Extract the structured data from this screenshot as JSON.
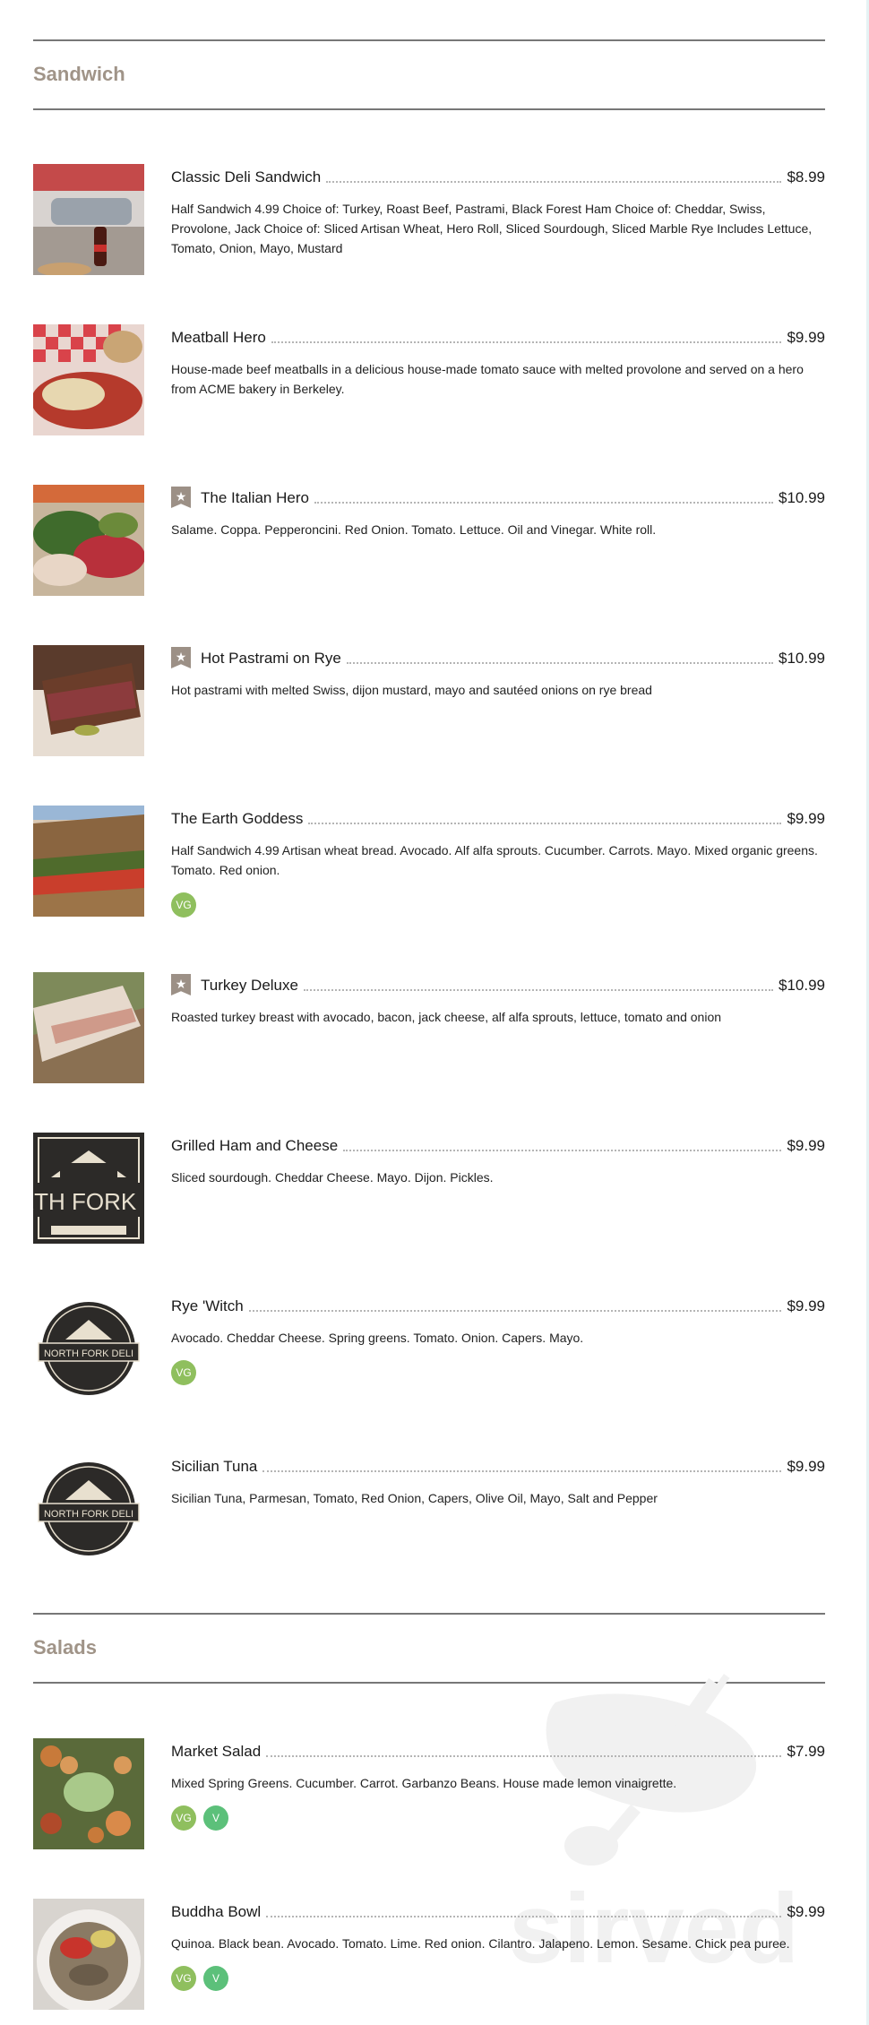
{
  "sections": [
    {
      "id": "sandwich",
      "title": "Sandwich"
    },
    {
      "id": "salads",
      "title": "Salads"
    }
  ],
  "items": [
    {
      "name": "Classic Deli Sandwich",
      "price": "$8.99",
      "featured": false,
      "description": "Half Sandwich 4.99 Choice of: Turkey, Roast Beef, Pastrami, Black Forest Ham Choice of: Cheddar, Swiss, Provolone, Jack Choice of: Sliced Artisan Wheat, Hero Roll, Sliced Sourdough, Sliced Marble Rye Includes Lettuce, Tomato, Onion, Mayo, Mustard",
      "tags": []
    },
    {
      "name": "Meatball Hero",
      "price": "$9.99",
      "featured": false,
      "description": "House-made beef meatballs in a delicious house-made tomato sauce with melted provolone and served on a hero from ACME bakery in Berkeley.",
      "tags": []
    },
    {
      "name": "The Italian Hero",
      "price": "$10.99",
      "featured": true,
      "description": "Salame. Coppa. Pepperoncini. Red Onion. Tomato. Lettuce. Oil and Vinegar. White roll.",
      "tags": []
    },
    {
      "name": "Hot Pastrami on Rye",
      "price": "$10.99",
      "featured": true,
      "description": "Hot pastrami with melted Swiss, dijon mustard, mayo and sautéed onions on rye bread",
      "tags": []
    },
    {
      "name": "The Earth Goddess",
      "price": "$9.99",
      "featured": false,
      "description": "Half Sandwich 4.99 Artisan wheat bread. Avocado. Alf alfa sprouts. Cucumber. Carrots. Mayo. Mixed organic greens. Tomato. Red onion.",
      "tags": [
        "VG"
      ]
    },
    {
      "name": "Turkey Deluxe",
      "price": "$10.99",
      "featured": true,
      "description": "Roasted turkey breast with avocado, bacon, jack cheese, alf alfa sprouts, lettuce, tomato and onion",
      "tags": []
    },
    {
      "name": "Grilled Ham and Cheese",
      "price": "$9.99",
      "featured": false,
      "description": "Sliced sourdough. Cheddar Cheese. Mayo. Dijon. Pickles.",
      "tags": []
    },
    {
      "name": "Rye 'Witch",
      "price": "$9.99",
      "featured": false,
      "description": "Avocado. Cheddar Cheese. Spring greens. Tomato. Onion. Capers. Mayo.",
      "tags": [
        "VG"
      ]
    },
    {
      "name": "Sicilian Tuna",
      "price": "$9.99",
      "featured": false,
      "description": "Sicilian Tuna, Parmesan, Tomato, Red Onion, Capers, Olive Oil, Mayo, Salt and Pepper",
      "tags": []
    },
    {
      "name": "Market Salad",
      "price": "$7.99",
      "featured": false,
      "description": "Mixed Spring Greens. Cucumber. Carrot. Garbanzo Beans. House made lemon vinaigrette.",
      "tags": [
        "VG",
        "V"
      ]
    },
    {
      "name": "Buddha Bowl",
      "price": "$9.99",
      "featured": false,
      "description": "Quinoa. Black bean. Avocado. Tomato. Lime. Red onion. Cilantro. Jalapeno. Lemon. Sesame. Chick pea puree.",
      "tags": [
        "VG",
        "V"
      ]
    }
  ],
  "logo_text": "NORTH FORK DELI",
  "watermark_text": "sirved",
  "icons": {
    "featured": "star-icon",
    "vegetarian": "vg-badge",
    "vegan": "v-badge"
  },
  "colors": {
    "section_title": "#a09488",
    "featured_badge": "#9c9086",
    "vg_badge": "#8fbf5e",
    "v_badge": "#5cc07a"
  }
}
